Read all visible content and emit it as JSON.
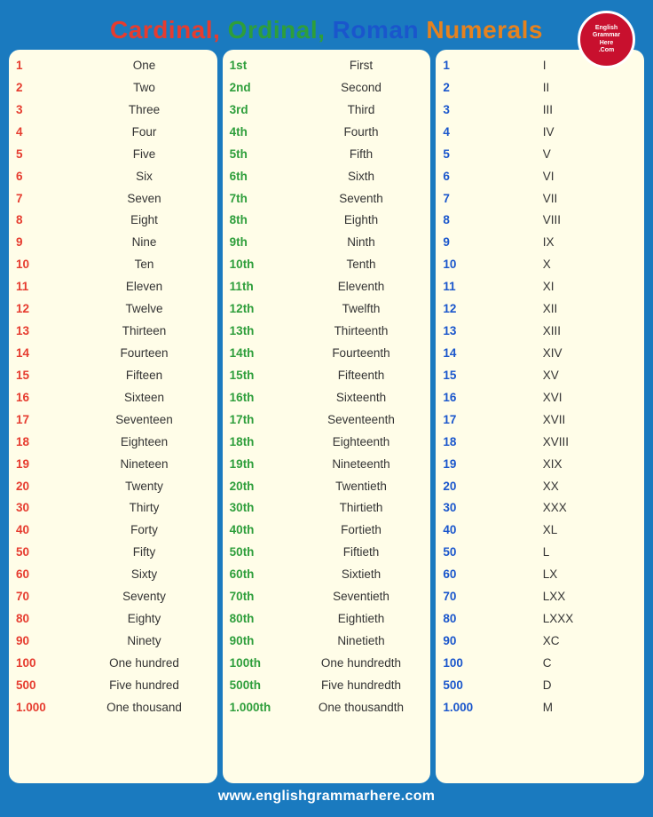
{
  "title": {
    "part1": "Cardinal, ",
    "part2": "Ordinal, ",
    "part3": "Roman ",
    "part4": "Numerals"
  },
  "footer": "www.englishgrammarhere.com",
  "cardinal": [
    {
      "num": "1",
      "word": "One"
    },
    {
      "num": "2",
      "word": "Two"
    },
    {
      "num": "3",
      "word": "Three"
    },
    {
      "num": "4",
      "word": "Four"
    },
    {
      "num": "5",
      "word": "Five"
    },
    {
      "num": "6",
      "word": "Six"
    },
    {
      "num": "7",
      "word": "Seven"
    },
    {
      "num": "8",
      "word": "Eight"
    },
    {
      "num": "9",
      "word": "Nine"
    },
    {
      "num": "10",
      "word": "Ten"
    },
    {
      "num": "11",
      "word": "Eleven"
    },
    {
      "num": "12",
      "word": "Twelve"
    },
    {
      "num": "13",
      "word": "Thirteen"
    },
    {
      "num": "14",
      "word": "Fourteen"
    },
    {
      "num": "15",
      "word": "Fifteen"
    },
    {
      "num": "16",
      "word": "Sixteen"
    },
    {
      "num": "17",
      "word": "Seventeen"
    },
    {
      "num": "18",
      "word": "Eighteen"
    },
    {
      "num": "19",
      "word": "Nineteen"
    },
    {
      "num": "20",
      "word": "Twenty"
    },
    {
      "num": "30",
      "word": "Thirty"
    },
    {
      "num": "40",
      "word": "Forty"
    },
    {
      "num": "50",
      "word": "Fifty"
    },
    {
      "num": "60",
      "word": "Sixty"
    },
    {
      "num": "70",
      "word": "Seventy"
    },
    {
      "num": "80",
      "word": "Eighty"
    },
    {
      "num": "90",
      "word": "Ninety"
    },
    {
      "num": "100",
      "word": "One hundred"
    },
    {
      "num": "500",
      "word": "Five hundred"
    },
    {
      "num": "1.000",
      "word": "One thousand"
    }
  ],
  "ordinal": [
    {
      "num": "1st",
      "word": "First"
    },
    {
      "num": "2nd",
      "word": "Second"
    },
    {
      "num": "3rd",
      "word": "Third"
    },
    {
      "num": "4th",
      "word": "Fourth"
    },
    {
      "num": "5th",
      "word": "Fifth"
    },
    {
      "num": "6th",
      "word": "Sixth"
    },
    {
      "num": "7th",
      "word": "Seventh"
    },
    {
      "num": "8th",
      "word": "Eighth"
    },
    {
      "num": "9th",
      "word": "Ninth"
    },
    {
      "num": "10th",
      "word": "Tenth"
    },
    {
      "num": "11th",
      "word": "Eleventh"
    },
    {
      "num": "12th",
      "word": "Twelfth"
    },
    {
      "num": "13th",
      "word": "Thirteenth"
    },
    {
      "num": "14th",
      "word": "Fourteenth"
    },
    {
      "num": "15th",
      "word": "Fifteenth"
    },
    {
      "num": "16th",
      "word": "Sixteenth"
    },
    {
      "num": "17th",
      "word": "Seventeenth"
    },
    {
      "num": "18th",
      "word": "Eighteenth"
    },
    {
      "num": "19th",
      "word": "Nineteenth"
    },
    {
      "num": "20th",
      "word": "Twentieth"
    },
    {
      "num": "30th",
      "word": "Thirtieth"
    },
    {
      "num": "40th",
      "word": "Fortieth"
    },
    {
      "num": "50th",
      "word": "Fiftieth"
    },
    {
      "num": "60th",
      "word": "Sixtieth"
    },
    {
      "num": "70th",
      "word": "Seventieth"
    },
    {
      "num": "80th",
      "word": "Eightieth"
    },
    {
      "num": "90th",
      "word": "Ninetieth"
    },
    {
      "num": "100th",
      "word": "One hundredth"
    },
    {
      "num": "500th",
      "word": "Five hundredth"
    },
    {
      "num": "1.000th",
      "word": "One thousandth"
    }
  ],
  "roman": [
    {
      "num": "1",
      "roman": "I"
    },
    {
      "num": "2",
      "roman": "II"
    },
    {
      "num": "3",
      "roman": "III"
    },
    {
      "num": "4",
      "roman": "IV"
    },
    {
      "num": "5",
      "roman": "V"
    },
    {
      "num": "6",
      "roman": "VI"
    },
    {
      "num": "7",
      "roman": "VII"
    },
    {
      "num": "8",
      "roman": "VIII"
    },
    {
      "num": "9",
      "roman": "IX"
    },
    {
      "num": "10",
      "roman": "X"
    },
    {
      "num": "11",
      "roman": "XI"
    },
    {
      "num": "12",
      "roman": "XII"
    },
    {
      "num": "13",
      "roman": "XIII"
    },
    {
      "num": "14",
      "roman": "XIV"
    },
    {
      "num": "15",
      "roman": "XV"
    },
    {
      "num": "16",
      "roman": "XVI"
    },
    {
      "num": "17",
      "roman": "XVII"
    },
    {
      "num": "18",
      "roman": "XVIII"
    },
    {
      "num": "19",
      "roman": "XIX"
    },
    {
      "num": "20",
      "roman": "XX"
    },
    {
      "num": "30",
      "roman": "XXX"
    },
    {
      "num": "40",
      "roman": "XL"
    },
    {
      "num": "50",
      "roman": "L"
    },
    {
      "num": "60",
      "roman": "LX"
    },
    {
      "num": "70",
      "roman": "LXX"
    },
    {
      "num": "80",
      "roman": "LXXX"
    },
    {
      "num": "90",
      "roman": "XC"
    },
    {
      "num": "100",
      "roman": "C"
    },
    {
      "num": "500",
      "roman": "D"
    },
    {
      "num": "1.000",
      "roman": "M"
    }
  ]
}
